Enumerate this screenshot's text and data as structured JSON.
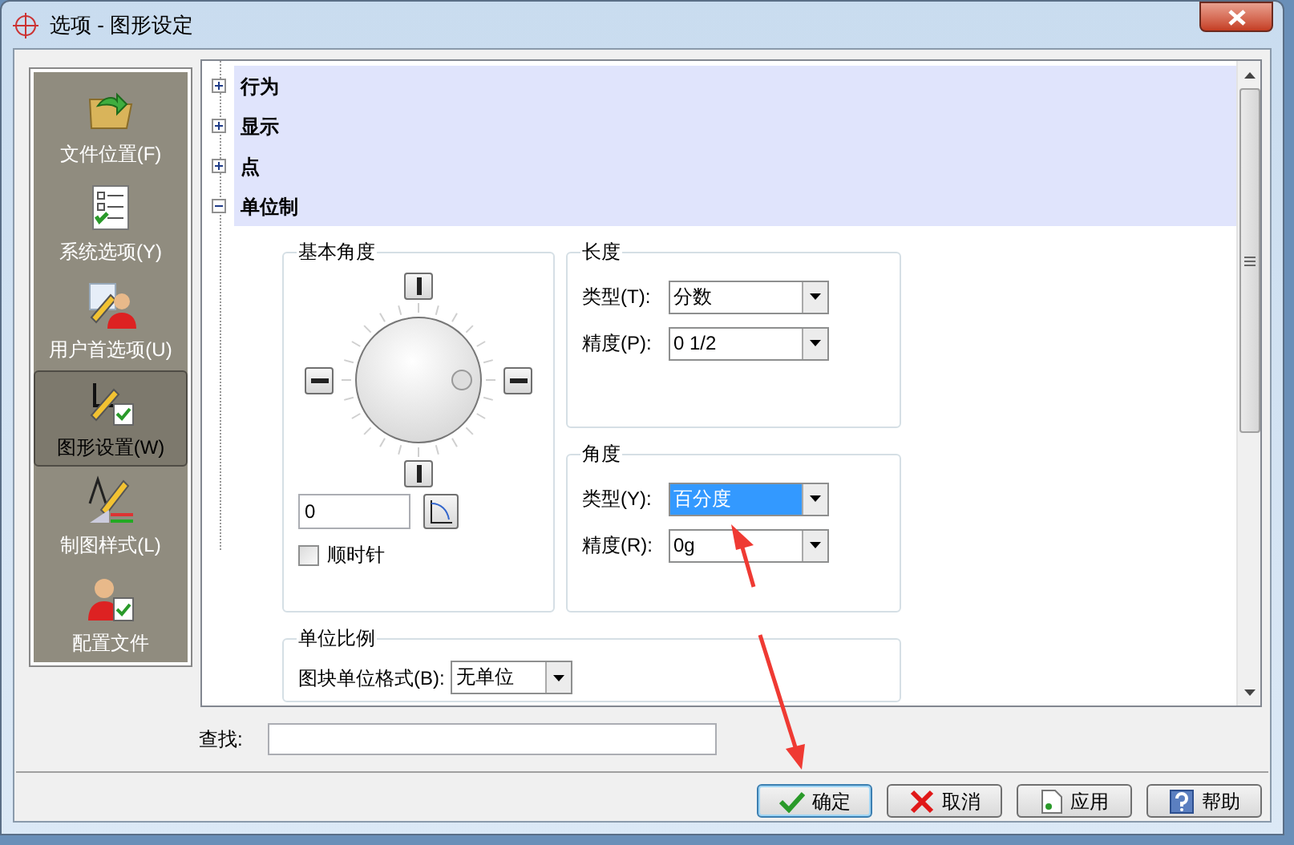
{
  "window": {
    "title": "选项 - 图形设定"
  },
  "sidebar": {
    "items": [
      {
        "label": "文件位置(F)",
        "selected": false
      },
      {
        "label": "系统选项(Y)",
        "selected": false
      },
      {
        "label": "用户首选项(U)",
        "selected": false
      },
      {
        "label": "图形设置(W)",
        "selected": true
      },
      {
        "label": "制图样式(L)",
        "selected": false
      },
      {
        "label": "配置文件",
        "selected": false
      }
    ]
  },
  "tree": {
    "sections": [
      {
        "label": "行为",
        "expanded": false
      },
      {
        "label": "显示",
        "expanded": false
      },
      {
        "label": "点",
        "expanded": false
      },
      {
        "label": "单位制",
        "expanded": true
      }
    ]
  },
  "base_angle": {
    "title": "基本角度",
    "value": "0",
    "clockwise": {
      "label": "顺时针",
      "checked": false
    }
  },
  "length": {
    "title": "长度",
    "fields": [
      {
        "label": "类型(T):",
        "value": "分数",
        "selected": false
      },
      {
        "label": "精度(P):",
        "value": "0 1/2",
        "selected": false
      }
    ]
  },
  "angle": {
    "title": "角度",
    "fields": [
      {
        "label": "类型(Y):",
        "value": "百分度",
        "selected": true
      },
      {
        "label": "精度(R):",
        "value": "0g",
        "selected": false
      }
    ]
  },
  "unit_scale": {
    "title": "单位比例",
    "fields": [
      {
        "label": "图块单位格式(B):",
        "value": "无单位",
        "selected": false
      }
    ]
  },
  "search": {
    "label": "查找:"
  },
  "buttons": [
    {
      "label": "确定",
      "kind": "ok"
    },
    {
      "label": "取消",
      "kind": "cancel"
    },
    {
      "label": "应用",
      "kind": "apply"
    },
    {
      "label": "帮助",
      "kind": "help"
    }
  ]
}
